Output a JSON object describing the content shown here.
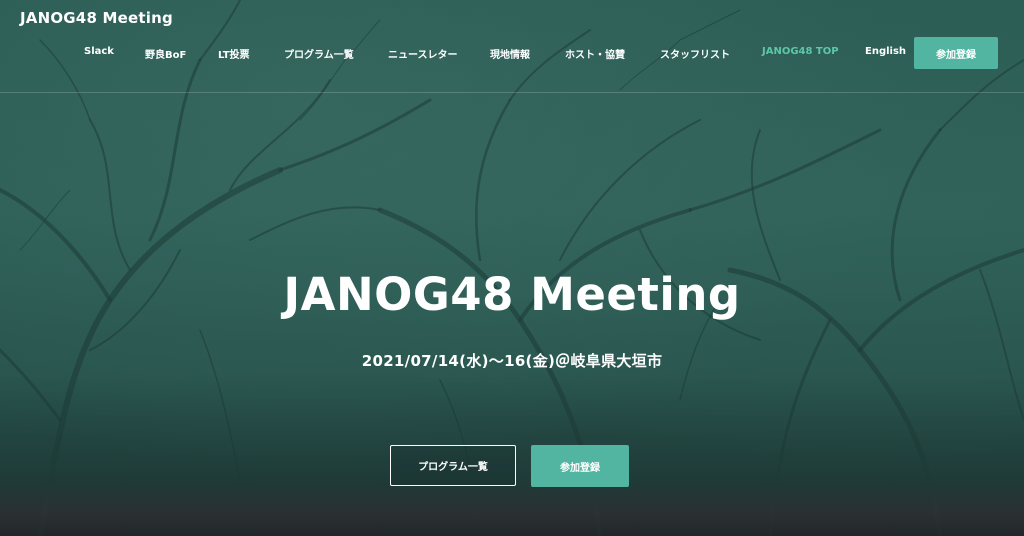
{
  "site": {
    "title": "JANOG48 Meeting"
  },
  "nav": {
    "items": [
      {
        "label": "Slack"
      },
      {
        "label": "野良BoF"
      },
      {
        "label": "LT投票"
      },
      {
        "label": "プログラム一覧"
      },
      {
        "label": "ニュースレター"
      },
      {
        "label": "現地情報"
      },
      {
        "label": "ホスト・協賛"
      },
      {
        "label": "スタッフリスト"
      },
      {
        "label": "JANOG48 TOP"
      },
      {
        "label": "English"
      }
    ],
    "active_label": "JANOG48 TOP",
    "cta_label": "参加登録"
  },
  "hero": {
    "title": "JANOG48 Meeting",
    "subtitle": "2021/07/14(水)〜16(金)＠岐阜県大垣市",
    "button_program": "プログラム一覧",
    "button_register": "参加登録"
  },
  "colors": {
    "accent": "#52b5a1",
    "active_nav": "#5fc6a8",
    "background_tint": "#2a5c54"
  }
}
